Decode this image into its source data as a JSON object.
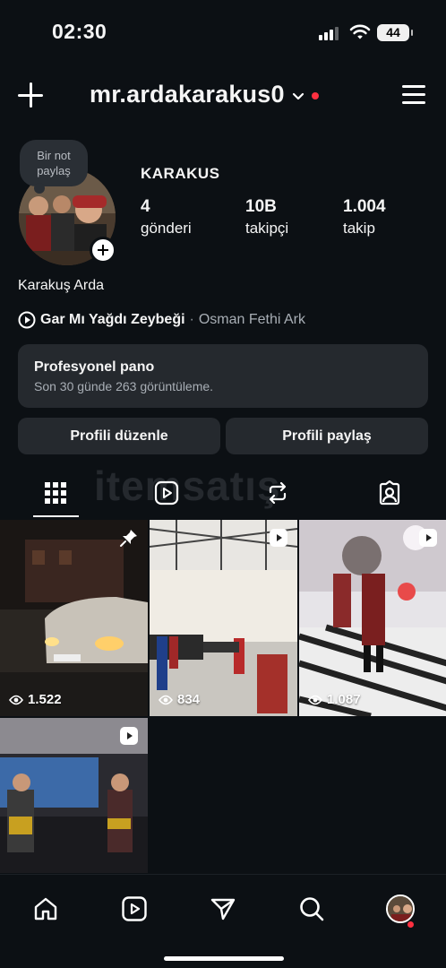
{
  "status_bar": {
    "time": "02:30",
    "battery": "44"
  },
  "header": {
    "username": "mr.ardakarakus0"
  },
  "profile": {
    "note_label": "Bir not\npaylaş",
    "display_name": "KARAKUS",
    "stats": [
      {
        "value": "4",
        "label": "gönderi"
      },
      {
        "value": "10B",
        "label": "takipçi"
      },
      {
        "value": "1.004",
        "label": "takip"
      }
    ],
    "full_name": "Karakuş Arda",
    "music": {
      "title": "Gar Mı Yağdı Zeybeği",
      "separator": "·",
      "artist": "Osman Fethi Ark"
    }
  },
  "dashboard": {
    "title": "Profesyonel pano",
    "subtitle": "Son 30 günde 263 görüntüleme."
  },
  "buttons": {
    "edit_profile": "Profili düzenle",
    "share_profile": "Profili paylaş"
  },
  "tabs": [
    "grid-icon",
    "reels-icon",
    "reposts-icon",
    "tagged-icon"
  ],
  "watermark": "itemsatış",
  "posts": [
    {
      "views": "1.522",
      "badge": "pin-icon",
      "scene": "night-car"
    },
    {
      "views": "834",
      "badge": "reel-icon",
      "scene": "hall-dance"
    },
    {
      "views": "1.087",
      "badge": "reel-icon",
      "scene": "wedding-dance"
    },
    {
      "views": "",
      "badge": "reel-icon",
      "scene": "stage-dance"
    }
  ],
  "bottom_nav": [
    "home-icon",
    "reels-icon",
    "send-icon",
    "search-icon",
    "profile-avatar"
  ],
  "colors": {
    "background": "#0c1014",
    "card": "#25292e",
    "notification": "#ff3040"
  }
}
